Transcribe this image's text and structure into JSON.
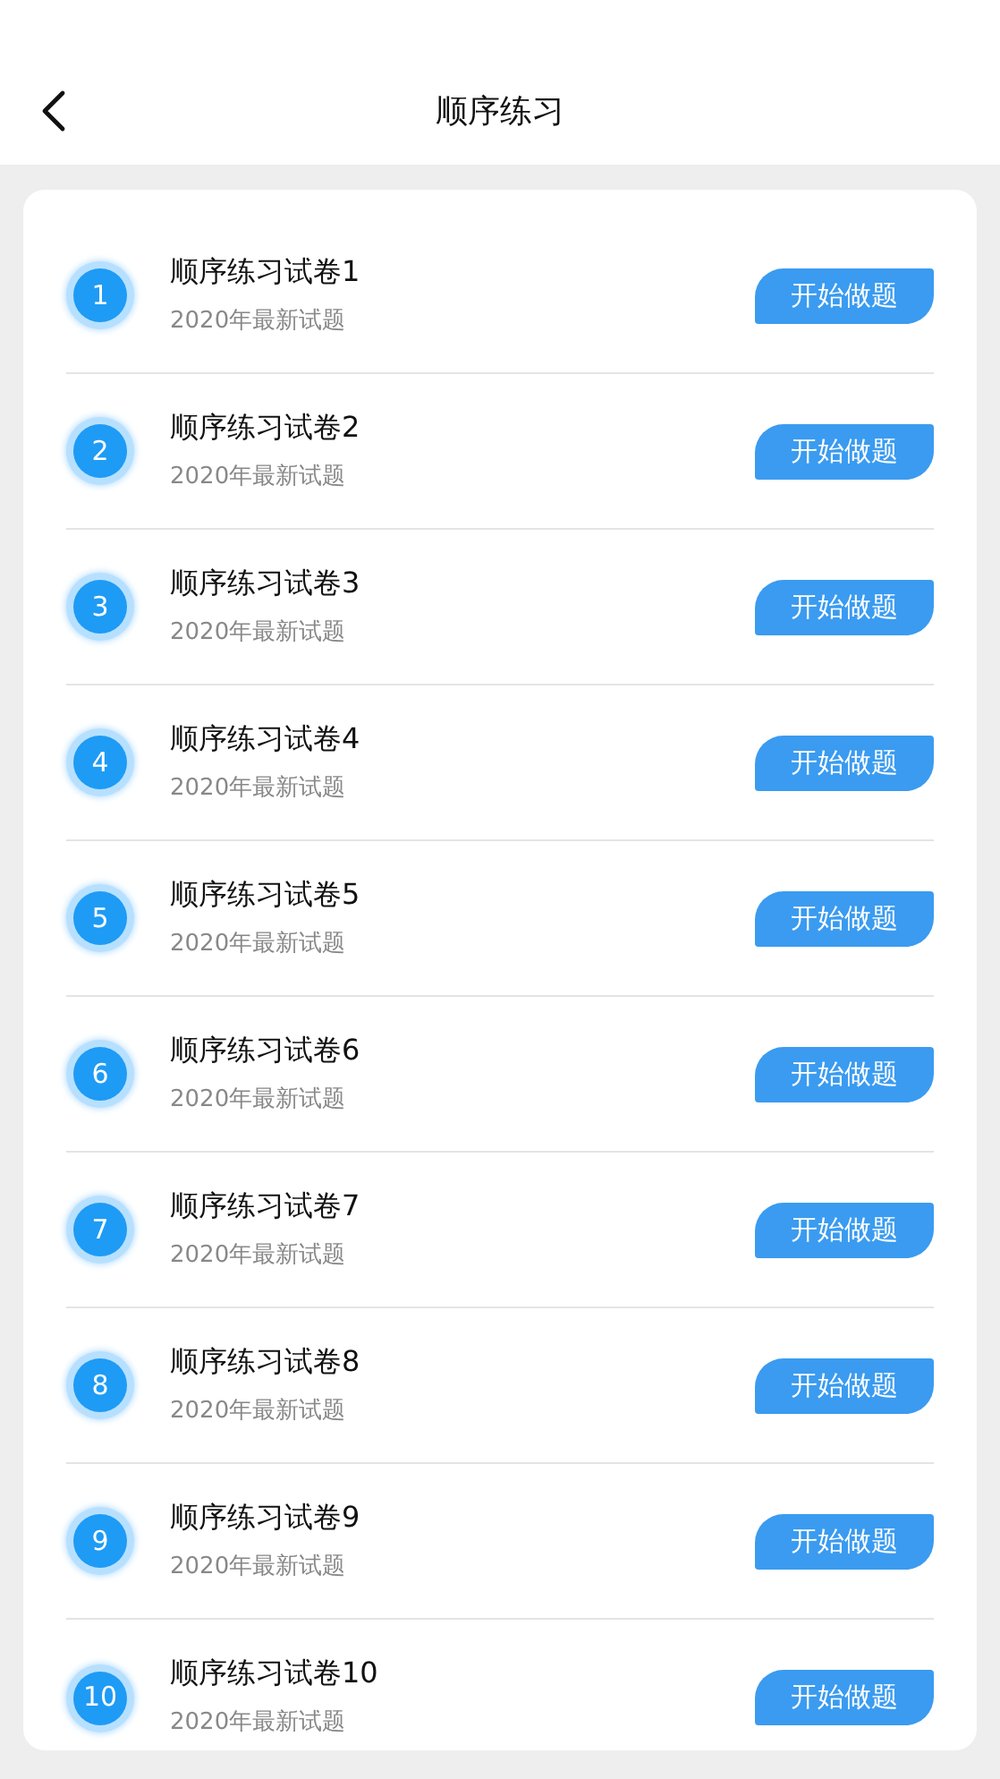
{
  "header": {
    "title": "顺序练习"
  },
  "papers": [
    {
      "number": "1",
      "title": "顺序练习试卷1",
      "subtitle": "2020年最新试题",
      "button": "开始做题"
    },
    {
      "number": "2",
      "title": "顺序练习试卷2",
      "subtitle": "2020年最新试题",
      "button": "开始做题"
    },
    {
      "number": "3",
      "title": "顺序练习试卷3",
      "subtitle": "2020年最新试题",
      "button": "开始做题"
    },
    {
      "number": "4",
      "title": "顺序练习试卷4",
      "subtitle": "2020年最新试题",
      "button": "开始做题"
    },
    {
      "number": "5",
      "title": "顺序练习试卷5",
      "subtitle": "2020年最新试题",
      "button": "开始做题"
    },
    {
      "number": "6",
      "title": "顺序练习试卷6",
      "subtitle": "2020年最新试题",
      "button": "开始做题"
    },
    {
      "number": "7",
      "title": "顺序练习试卷7",
      "subtitle": "2020年最新试题",
      "button": "开始做题"
    },
    {
      "number": "8",
      "title": "顺序练习试卷8",
      "subtitle": "2020年最新试题",
      "button": "开始做题"
    },
    {
      "number": "9",
      "title": "顺序练习试卷9",
      "subtitle": "2020年最新试题",
      "button": "开始做题"
    },
    {
      "number": "10",
      "title": "顺序练习试卷10",
      "subtitle": "2020年最新试题",
      "button": "开始做题"
    }
  ]
}
